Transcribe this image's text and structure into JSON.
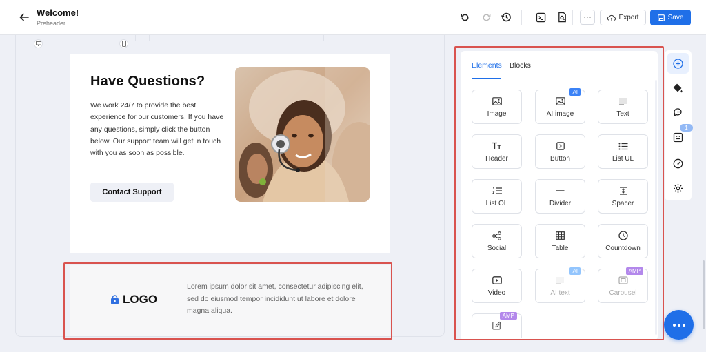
{
  "header": {
    "title": "Welcome!",
    "subtitle": "Preheader",
    "export_label": "Export",
    "save_label": "Save",
    "more_label": "···"
  },
  "email": {
    "heading": "Have Questions?",
    "body": "We work 24/7 to provide the best experience for our customers. If you have any questions, simply click the button below. Our support team will get in touch with you as soon as possible.",
    "button_label": "Contact Support",
    "footer_logo": "LOGO",
    "footer_text": "Lorem ipsum dolor sit amet, consectetur adipiscing elit, sed do eiusmod tempor incididunt ut labore et dolore magna aliqua."
  },
  "panel": {
    "tabs": [
      "Elements",
      "Blocks"
    ],
    "active_tab": "Elements",
    "elements": [
      {
        "label": "Image",
        "icon": "image-icon"
      },
      {
        "label": "AI image",
        "icon": "ai-image-icon",
        "badge": "AI"
      },
      {
        "label": "Text",
        "icon": "text-icon"
      },
      {
        "label": "Header",
        "icon": "header-icon"
      },
      {
        "label": "Button",
        "icon": "button-icon"
      },
      {
        "label": "List UL",
        "icon": "list-ul-icon"
      },
      {
        "label": "List OL",
        "icon": "list-ol-icon"
      },
      {
        "label": "Divider",
        "icon": "divider-icon"
      },
      {
        "label": "Spacer",
        "icon": "spacer-icon"
      },
      {
        "label": "Social",
        "icon": "social-icon"
      },
      {
        "label": "Table",
        "icon": "table-icon"
      },
      {
        "label": "Countdown",
        "icon": "countdown-icon"
      },
      {
        "label": "Video",
        "icon": "video-icon"
      },
      {
        "label": "AI text",
        "icon": "ai-text-icon",
        "badge": "AI"
      },
      {
        "label": "Carousel",
        "icon": "carousel-icon",
        "badge": "AMP"
      },
      {
        "label": "",
        "icon": "form-icon",
        "badge": "AMP"
      }
    ]
  },
  "rail": {
    "comments_badge": "1"
  },
  "colors": {
    "accent": "#1f6fe8",
    "highlight": "#d9534f"
  }
}
